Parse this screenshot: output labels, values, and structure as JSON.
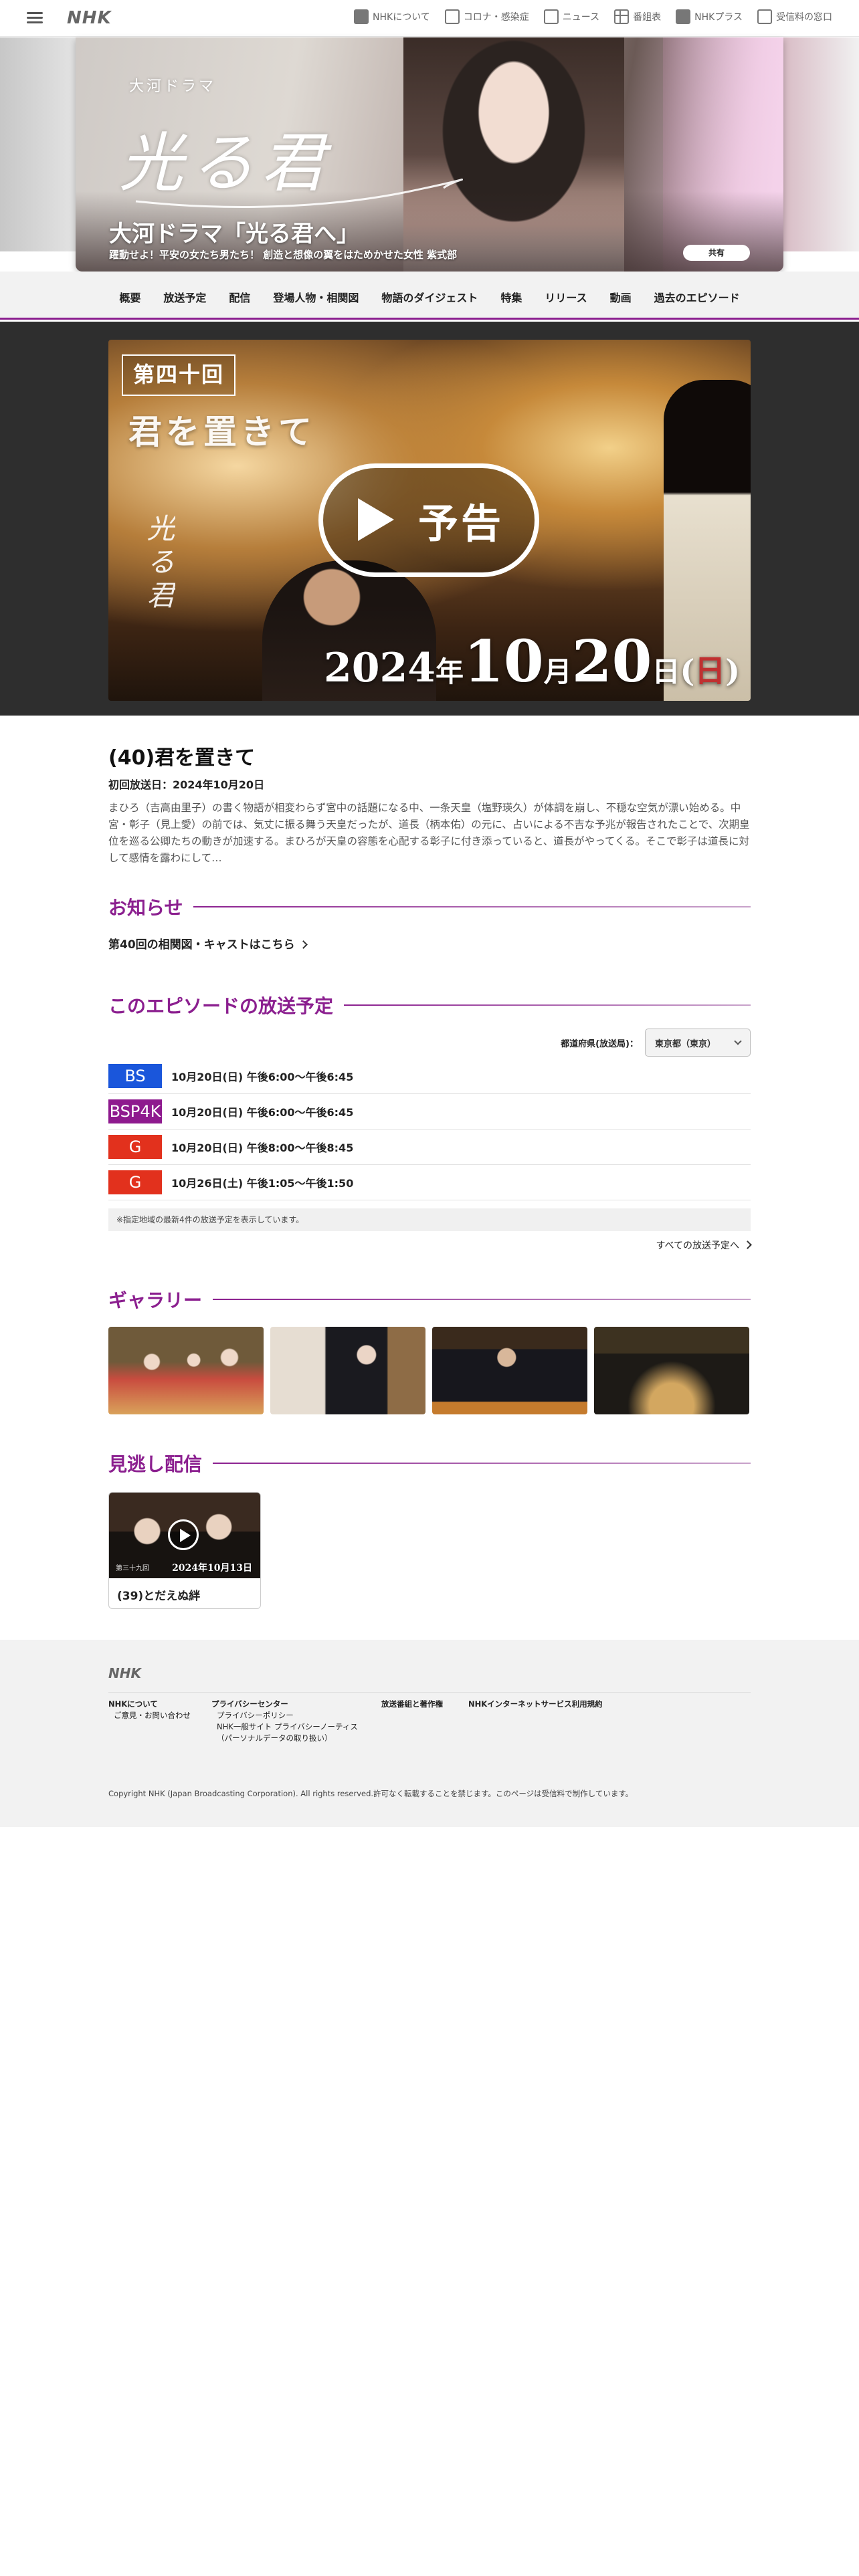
{
  "topbar": {
    "logo": "NHK",
    "links": [
      "NHKについて",
      "コロナ・感染症",
      "ニュース",
      "番組表",
      "NHKプラス",
      "受信料の窓口"
    ]
  },
  "hero": {
    "small_title": "大河ドラマ",
    "calligraphy": "光る君",
    "title": "大河ドラマ「光る君へ」",
    "subtitle": "躍動せよ！平安の女たち男たち！ 創造と想像の翼をはためかせた女性 紫式部",
    "share_label": "共有"
  },
  "program_nav": [
    "概要",
    "放送予定",
    "配信",
    "登場人物・相関図",
    "物語のダイジェスト",
    "特集",
    "リリース",
    "動画",
    "過去のエピソード"
  ],
  "video": {
    "episode_box": "第四十回",
    "episode_title": "君を置きて",
    "side_logo": "光る君",
    "play_label": "予告",
    "date_year": "2024",
    "date_year_unit": "年",
    "date_month": "10",
    "date_month_unit": "月",
    "date_day": "20",
    "date_day_unit": "日",
    "date_paren_open": "(",
    "date_dow": "日",
    "date_paren_close": ")"
  },
  "episode": {
    "heading": "(40)君を置きて",
    "first_air": "初回放送日：2024年10月20日",
    "synopsis": "まひろ（吉高由里子）の書く物語が相変わらず宮中の話題になる中、一条天皇（塩野瑛久）が体調を崩し、不穏な空気が漂い始める。中宮・彰子（見上愛）の前では、気丈に振る舞う天皇だったが、道長（柄本佑）の元に、占いによる不吉な予兆が報告されたことで、次期皇位を巡る公卿たちの動きが加速する。まひろが天皇の容態を心配する彰子に付き添っていると、道長がやってくる。そこで彰子は道長に対して感情を露わにして…"
  },
  "news": {
    "title": "お知らせ",
    "link": "第40回の相関図・キャストはこちら"
  },
  "schedule": {
    "title": "このエピソードの放送予定",
    "pref_label": "都道府県(放送局)：",
    "pref_value": "東京都（東京）",
    "rows": [
      {
        "channel": "BS",
        "color": "#1a56db",
        "time": "10月20日(日) 午後6:00〜午後6:45"
      },
      {
        "channel": "BSP4K",
        "color": "#8e1a8e",
        "time": "10月20日(日) 午後6:00〜午後6:45"
      },
      {
        "channel": "G",
        "color": "#e2311d",
        "time": "10月20日(日) 午後8:00〜午後8:45"
      },
      {
        "channel": "G",
        "color": "#e2311d",
        "time": "10月26日(土) 午後1:05〜午後1:50"
      }
    ],
    "note": "※指定地域の最新4件の放送予定を表示しています。",
    "all_link": "すべての放送予定へ"
  },
  "gallery": {
    "title": "ギャラリー"
  },
  "vod": {
    "title": "見逃し配信",
    "card_title": "(39)とだえぬ絆",
    "card_date": "2024年10月13日",
    "card_ep": "第三十九回"
  },
  "footer": {
    "logo": "NHK",
    "col1_main": "NHKについて",
    "col1_sub": "ご意見・お問い合わせ",
    "col2_main": "プライバシーセンター",
    "col2_sub1": "プライバシーポリシー",
    "col2_sub2": "NHK一般サイト プライバシーノーティス",
    "col2_sub3": "（パーソナルデータの取り扱い）",
    "col3_main": "放送番組と著作権",
    "col4_main": "NHKインターネットサービス利用規約",
    "copyright": "Copyright NHK (Japan Broadcasting Corporation). All rights reserved.許可なく転載することを禁じます。このページは受信料で制作しています。"
  },
  "colors": {
    "accent": "#8b1f8f",
    "bs": "#1a56db",
    "bsp4k": "#8e1a8e",
    "g": "#e2311d"
  }
}
